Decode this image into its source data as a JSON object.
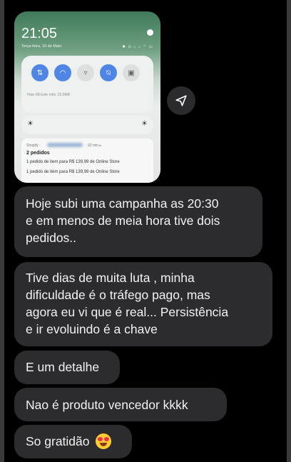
{
  "screenshot": {
    "time": "21:05",
    "date": "Terça-feira, 10 de Maio",
    "status_icons": "✱ ⊙ ᵢₗ ᵢₗ ⌔ ▭",
    "usage": "Hoje 0B   Este mês: 22,0MB",
    "notification": {
      "app": "Shopify ·",
      "ago": "· 92 min ▸",
      "title": "2 pedidos",
      "line1": "1 pedido de item para R$ 139,99 de Online Store",
      "line2": "1 pedido de item para R$ 139,99 de Online Store"
    }
  },
  "messages": {
    "m1": [
      "Hoje subi uma campanha as 20:30",
      "e em menos de meia hora tive dois",
      "pedidos.."
    ],
    "m2": [
      "Tive dias de muita luta , minha",
      "dificuldade é o tráfego pago, mas",
      "agora eu vi que é real... Persistência",
      "e ir evoluindo é a chave"
    ],
    "m3": "E um detalhe",
    "m4": "Nao é produto vencedor kkkk",
    "m5": "So gratidão"
  },
  "colors": {
    "bubble": "#2c2c2f",
    "toggle_on": "#4f86e6"
  },
  "icons": {
    "forward": "forward-icon",
    "emoji": "heart-eyes-emoji-icon"
  }
}
